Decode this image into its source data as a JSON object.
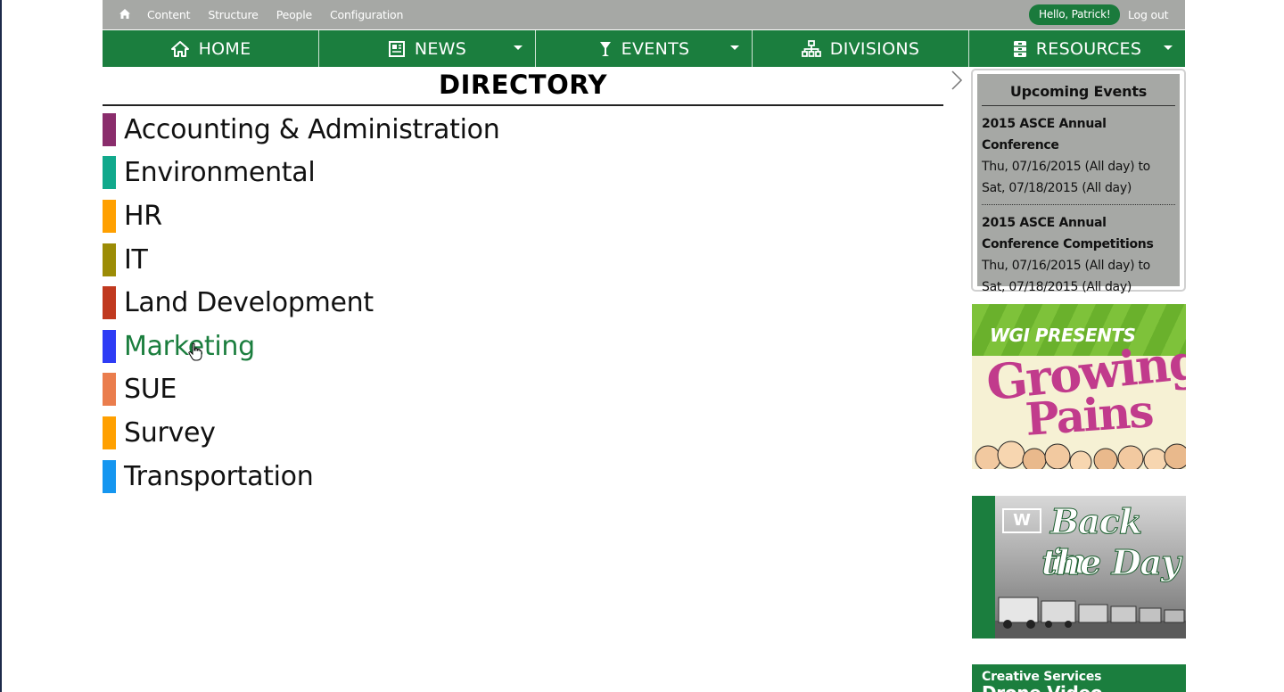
{
  "admin_bar": {
    "links": [
      "Content",
      "Structure",
      "People",
      "Configuration"
    ],
    "user_greeting": "Hello, Patrick!",
    "logout": "Log out"
  },
  "main_nav": {
    "items": [
      {
        "label": "HOME",
        "icon": "home-icon",
        "has_dropdown": false
      },
      {
        "label": "NEWS",
        "icon": "newspaper-icon",
        "has_dropdown": true
      },
      {
        "label": "EVENTS",
        "icon": "glass-icon",
        "has_dropdown": true
      },
      {
        "label": "DIVISIONS",
        "icon": "org-chart-icon",
        "has_dropdown": false
      },
      {
        "label": "RESOURCES",
        "icon": "file-cabinet-icon",
        "has_dropdown": true
      }
    ]
  },
  "directory": {
    "title": "DIRECTORY",
    "items": [
      {
        "name": "Accounting & Administration",
        "color": "#8a2d6c"
      },
      {
        "name": "Environmental",
        "color": "#11a98c"
      },
      {
        "name": "HR",
        "color": "#ffa000"
      },
      {
        "name": "IT",
        "color": "#9c8c06"
      },
      {
        "name": "Land Development",
        "color": "#c0391f"
      },
      {
        "name": "Marketing",
        "color": "#2e3cf5"
      },
      {
        "name": "SUE",
        "color": "#ea7d4d"
      },
      {
        "name": "Survey",
        "color": "#ffa000"
      },
      {
        "name": "Transportation",
        "color": "#1596f0"
      }
    ],
    "hovered_item": "Marketing"
  },
  "upcoming_events": {
    "title": "Upcoming Events",
    "events": [
      {
        "title": "2015 ASCE Annual Conference",
        "date": "Thu, 07/16/2015 (All day) to Sat, 07/18/2015 (All day)"
      },
      {
        "title": "2015 ASCE Annual Conference Competitions",
        "date": "Thu, 07/16/2015 (All day) to Sat, 07/18/2015 (All day)"
      }
    ]
  },
  "banners": {
    "growing_pains": {
      "sub": "WGI PRESENTS",
      "line1": "Growing",
      "line2": "Pains"
    },
    "back_in_the_day": {
      "logo": "W",
      "line1": "Back in",
      "line2": "the Day"
    },
    "creative_services": {
      "line1": "Creative Services",
      "line2": "Drone Video"
    }
  },
  "colors": {
    "brand_green": "#1b7e3e",
    "admin_gray": "#a6a8a5",
    "hover_link": "#1b7e3e"
  }
}
